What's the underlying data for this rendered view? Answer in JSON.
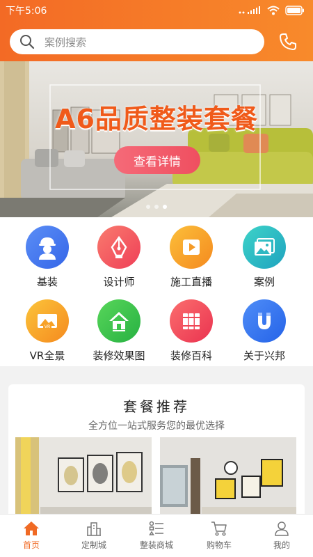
{
  "status_bar": {
    "time": "下午5:06",
    "battery": ""
  },
  "search": {
    "placeholder": "案例搜索"
  },
  "banner": {
    "title": "A6品质整装套餐",
    "button": "查看详情",
    "slides": 3,
    "active_slide": 2
  },
  "grid": [
    {
      "label": "基装",
      "icon": "worker-icon",
      "color": "#4a7ef2"
    },
    {
      "label": "设计师",
      "icon": "pen-nib-icon",
      "color": "#f5595f"
    },
    {
      "label": "施工直播",
      "icon": "play-icon",
      "color": "#f8a22e"
    },
    {
      "label": "案例",
      "icon": "picture-icon",
      "color": "#2fc0c4"
    },
    {
      "label": "VR全景",
      "icon": "vr-icon",
      "color": "#f7a126"
    },
    {
      "label": "装修效果图",
      "icon": "house-icon",
      "color": "#3cc54a"
    },
    {
      "label": "装修百科",
      "icon": "books-icon",
      "color": "#f04857"
    },
    {
      "label": "关于兴邦",
      "icon": "magnet-icon",
      "color": "#3a7af2"
    }
  ],
  "recommend": {
    "title": "套餐推荐",
    "subtitle": "全方位一站式服务您的最优选择"
  },
  "tabbar": [
    {
      "label": "首页",
      "icon": "home-icon",
      "active": true
    },
    {
      "label": "定制城",
      "icon": "city-icon",
      "active": false
    },
    {
      "label": "整装商城",
      "icon": "list-icon",
      "active": false
    },
    {
      "label": "购物车",
      "icon": "cart-icon",
      "active": false
    },
    {
      "label": "我的",
      "icon": "user-icon",
      "active": false
    }
  ],
  "colors": {
    "brand": "#f36a25",
    "tab_active": "#f06a24"
  }
}
